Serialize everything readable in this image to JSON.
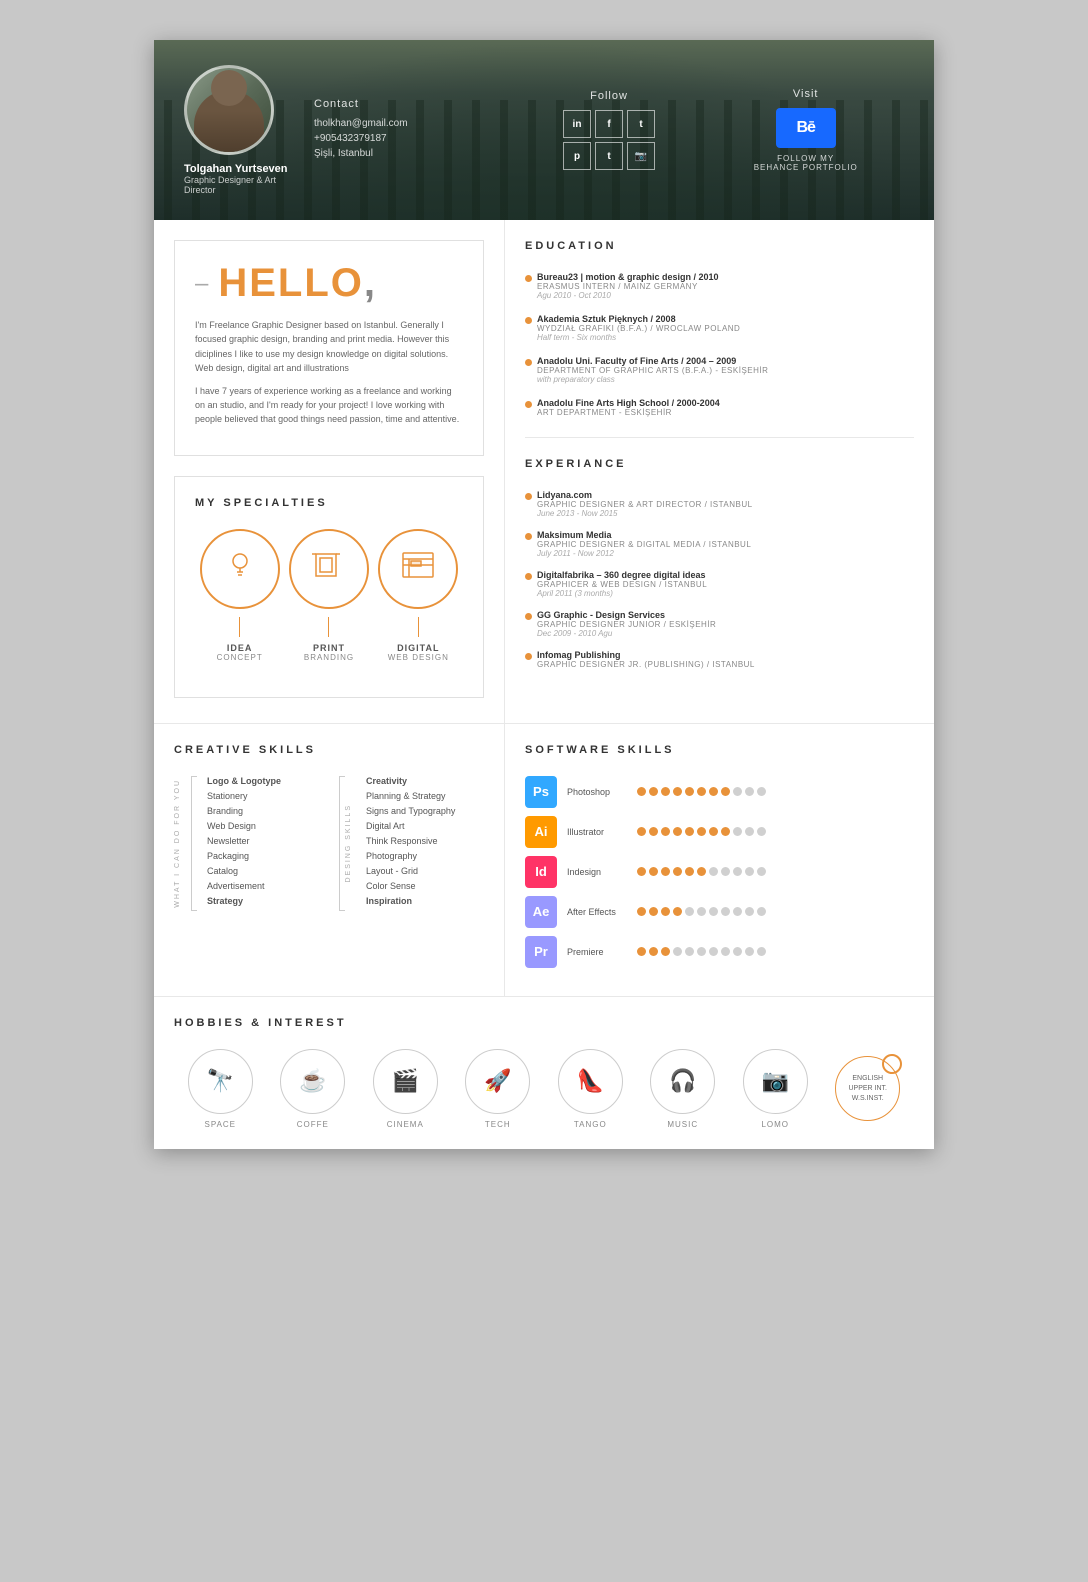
{
  "header": {
    "name": "Tolgahan Yurtseven",
    "title": "Graphic Designer & Art Director",
    "contact_label": "Contact",
    "email": "tholkhan@gmail.com",
    "phone": "+905432379187",
    "location": "Şişli, Istanbul",
    "follow_label": "Follow",
    "visit_label": "Visit",
    "behance_text": "FOLLOW MY\nBEHANCE PORTFOLIO",
    "social_icons": [
      "in",
      "f",
      "t",
      "p",
      "t",
      "📷"
    ]
  },
  "hello": {
    "title": "HELLO,",
    "dash": "–",
    "para1": "I'm Freelance Graphic Designer based on Istanbul. Generally I focused graphic design, branding and print media. However this diciplines I like to use my design knowledge on digital solutions. Web design, digital art and illustrations",
    "para2": "I have 7 years of experience working as a freelance and working on an studio, and I'm ready for your project! I love working with people believed that good things need passion, time and attentive."
  },
  "specialties": {
    "title": "MY SPECIALTIES",
    "items": [
      {
        "label": "IDEA",
        "sub": "CONCEPT",
        "icon": "💡"
      },
      {
        "label": "PRINT",
        "sub": "BRANDING",
        "icon": "🖼"
      },
      {
        "label": "DIGITAL",
        "sub": "WEB DESIGN",
        "icon": "🖥"
      }
    ]
  },
  "education": {
    "title": "EDUCATION",
    "items": [
      {
        "title": "Bureau23 | motion & graphic design / 2010",
        "sub": "ERASMUS INTERN / MAINZ GERMANY",
        "date": "Agu 2010 - Oct 2010"
      },
      {
        "title": "Akademia Sztuk Pięknych / 2008",
        "sub": "WYDZIAŁ GRAFIKI (B.F.A.) / WROCLAW POLAND",
        "date": "Half term - Six months"
      },
      {
        "title": "Anadolu Uni. Faculty of Fine Arts / 2004 – 2009",
        "sub": "DEPARTMENT OF GRAPHIC ARTS (B.F.A.) - ESKİŞEHİR",
        "date": "with preparatory class"
      },
      {
        "title": "Anadolu Fine Arts High School / 2000-2004",
        "sub": "ART DEPARTMENT - ESKİŞEHİR",
        "date": ""
      }
    ]
  },
  "experience": {
    "title": "EXPERIANCE",
    "items": [
      {
        "title": "Lidyana.com",
        "sub": "GRAPHIC DESIGNER & ART DIRECTOR / ISTANBUL",
        "date": "June 2013 - Now 2015"
      },
      {
        "title": "Maksimum Media",
        "sub": "GRAPHIC DESIGNER & DIGITAL MEDIA / ISTANBUL",
        "date": "July 2011 - Now 2012"
      },
      {
        "title": "Digitalfabrika – 360 degree digital ideas",
        "sub": "GRAPHICER & WEB DESIGN / ISTANBUL",
        "date": "April 2011 (3 months)"
      },
      {
        "title": "GG Graphic - Design Services",
        "sub": "GRAPHIC DESIGNER JUNIOR / ESKİŞEHİR",
        "date": "Dec 2009 - 2010 Agu"
      },
      {
        "title": "Infomag Publishing",
        "sub": "GRAPHIC DESIGNER JR. (PUBLISHING) / ISTANBUL",
        "date": ""
      }
    ]
  },
  "creative_skills": {
    "title": "CREATIVE SKILLS",
    "what_label": "WHAT I CAN DO FOR YOU",
    "desing_label": "DESING SKILLS",
    "left_items": [
      "Logo & Logotype",
      "Stationery",
      "Branding",
      "Web Design",
      "Newsletter",
      "Packaging",
      "Catalog",
      "Advertisement",
      "Strategy"
    ],
    "right_items": [
      "Creativity",
      "Planning & Strategy",
      "Signs and Typography",
      "Digital Art",
      "Think Responsive",
      "Photography",
      "Layout - Grid",
      "Color Sense",
      "Inspiration"
    ]
  },
  "software_skills": {
    "title": "SOFTWARE SKILLS",
    "items": [
      {
        "name": "Photoshop",
        "badge": "Ps",
        "color": "#31a8ff",
        "filled": 8,
        "total": 11
      },
      {
        "name": "Illustrator",
        "badge": "Ai",
        "color": "#ff9a00",
        "filled": 8,
        "total": 11
      },
      {
        "name": "Indesign",
        "badge": "Id",
        "color": "#ff3366",
        "filled": 6,
        "total": 11
      },
      {
        "name": "After Effects",
        "badge": "Ae",
        "color": "#9999ff",
        "filled": 4,
        "total": 11
      },
      {
        "name": "Premiere",
        "badge": "Pr",
        "color": "#9999ff",
        "filled": 3,
        "total": 11
      }
    ]
  },
  "hobbies": {
    "title": "HOBBIES & INTEREST",
    "items": [
      {
        "label": "SPACE",
        "icon": "🔭"
      },
      {
        "label": "COFFE",
        "icon": "☕"
      },
      {
        "label": "CINEMA",
        "icon": "🎬"
      },
      {
        "label": "TECH",
        "icon": "🚀"
      },
      {
        "label": "TANGO",
        "icon": "👠"
      },
      {
        "label": "MUSIC",
        "icon": "🎧"
      },
      {
        "label": "LOMO",
        "icon": "📷"
      }
    ],
    "language": {
      "lines": [
        "ENGLISH",
        "UPPER INT.",
        "W.S.INST."
      ]
    }
  }
}
